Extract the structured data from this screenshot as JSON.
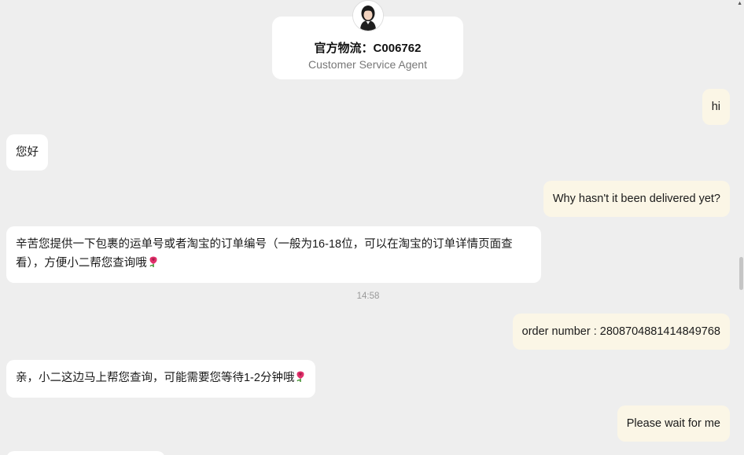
{
  "agent": {
    "name": "官方物流：C006762",
    "role": "Customer Service Agent"
  },
  "messages": [
    {
      "sender": "user",
      "text": "hi"
    },
    {
      "sender": "agent",
      "text": "您好"
    },
    {
      "sender": "user",
      "text": "Why hasn't it been delivered yet?"
    },
    {
      "sender": "agent",
      "text": "辛苦您提供一下包裹的运单号或者淘宝的订单编号（一般为16-18位，可以在淘宝的订单详情页面查看），方便小二帮您查询哦"
    },
    {
      "sender": "user",
      "text": "order number : 2808704881414849768"
    },
    {
      "sender": "agent",
      "text": "亲，小二这边马上帮您查询，可能需要您等待1-2分钟哦"
    },
    {
      "sender": "user",
      "text": "Please wait for me"
    }
  ],
  "timestamp": "14:58",
  "icons": {
    "avatar": "agent-avatar",
    "emoji": "rose-emoji",
    "scroll_up": "scroll-up-arrow-icon"
  },
  "colors": {
    "background": "#eeeeee",
    "user_bubble": "#fbf6e6",
    "agent_bubble": "#ffffff",
    "rose": "#e0306a"
  }
}
